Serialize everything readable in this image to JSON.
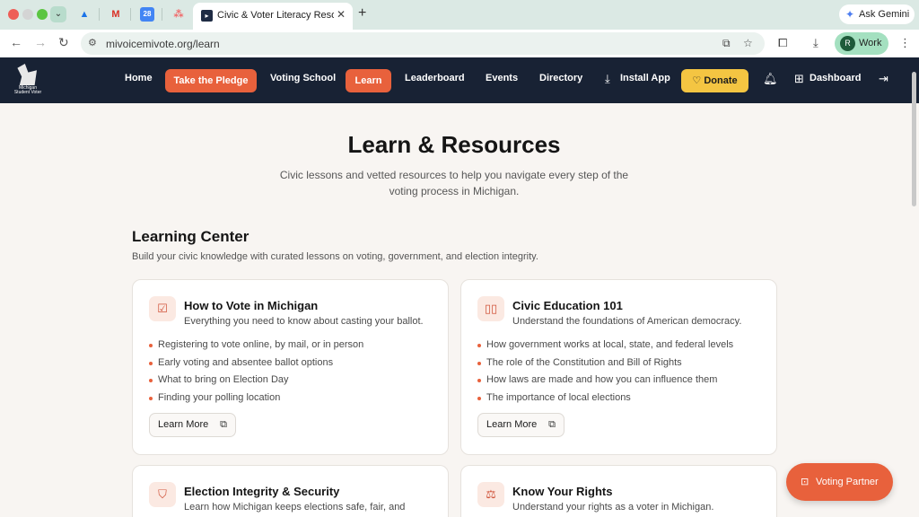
{
  "browser": {
    "active_tab_title": "Civic & Voter Literacy Resources",
    "new_tab_symbol": "+",
    "close_symbol": "✕",
    "pinned": {
      "drive": "▲",
      "gmail": "M",
      "calendar": "28",
      "asana": "⁂"
    },
    "ask_gemini": "Ask Gemini",
    "url": "mivoicemivote.org/learn",
    "profile_initial": "R",
    "profile_label": "Work"
  },
  "nav": {
    "logo_text": "Michigan Student Voter",
    "home": "Home",
    "pledge": "Take the Pledge",
    "voting_school": "Voting School",
    "learn": "Learn",
    "leaderboard": "Leaderboard",
    "events": "Events",
    "directory": "Directory",
    "install": "Install App",
    "donate": "Donate",
    "dashboard": "Dashboard"
  },
  "hero": {
    "title": "Learn & Resources",
    "subtitle": "Civic lessons and vetted resources to help you navigate every step of the voting process in Michigan."
  },
  "learning_center": {
    "title": "Learning Center",
    "subtitle": "Build your civic knowledge with curated lessons on voting, government, and election integrity.",
    "cards": [
      {
        "title": "How to Vote in Michigan",
        "desc": "Everything you need to know about casting your ballot.",
        "items": [
          "Registering to vote online, by mail, or in person",
          "Early voting and absentee ballot options",
          "What to bring on Election Day",
          "Finding your polling location"
        ],
        "button": "Learn More"
      },
      {
        "title": "Civic Education 101",
        "desc": "Understand the foundations of American democracy.",
        "items": [
          "How government works at local, state, and federal levels",
          "The role of the Constitution and Bill of Rights",
          "How laws are made and how you can influence them",
          "The importance of local elections"
        ],
        "button": "Learn More"
      },
      {
        "title": "Election Integrity & Security",
        "desc": "Learn how Michigan keeps elections safe, fair, and"
      },
      {
        "title": "Know Your Rights",
        "desc": "Understand your rights as a voter in Michigan."
      }
    ]
  },
  "voting_partner": "Voting Partner",
  "colors": {
    "accent": "#e8613c",
    "navy": "#182234",
    "gold": "#f4c542"
  }
}
